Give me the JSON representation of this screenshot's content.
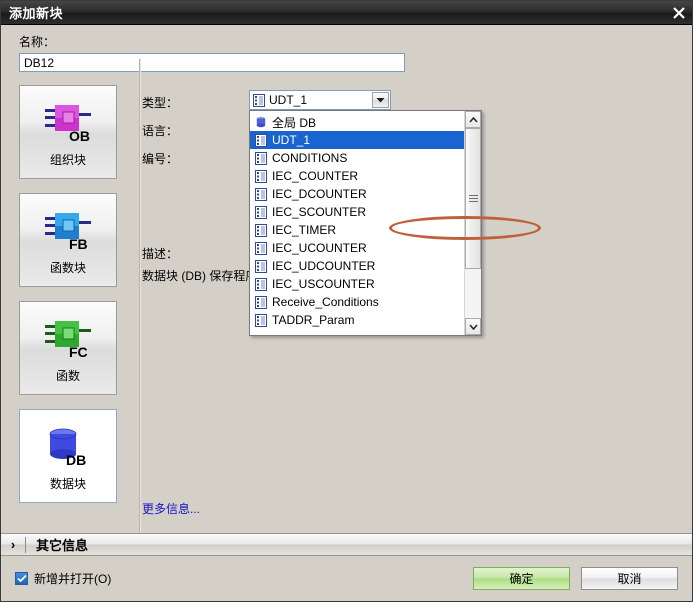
{
  "window": {
    "title": "添加新块",
    "close_icon": "close-icon"
  },
  "name_field": {
    "label": "名称：",
    "value": "DB12"
  },
  "block_types": [
    {
      "label": "组织块",
      "badge": "OB",
      "icon": "organization-block-icon",
      "color": "#cc33cc",
      "selected": false
    },
    {
      "label": "函数块",
      "badge": "FB",
      "icon": "function-block-icon",
      "color": "#1e90e0",
      "selected": false
    },
    {
      "label": "函数",
      "badge": "FC",
      "icon": "function-icon",
      "color": "#33aa33",
      "selected": false
    },
    {
      "label": "数据块",
      "badge": "DB",
      "icon": "data-block-icon",
      "color": "#3a44d8",
      "selected": true
    }
  ],
  "form": {
    "type_label": "类型：",
    "language_label": "语言：",
    "number_label": "编号：",
    "description_label": "描述：",
    "description_text": "数据块 (DB) 保存程序",
    "more_info_link": "更多信息..."
  },
  "combobox": {
    "value": "UDT_1",
    "icon": "udt-icon",
    "arrow_icon": "chevron-down-icon",
    "options": [
      {
        "label": "全局 DB",
        "icon": "global-db-icon",
        "selected": false
      },
      {
        "label": "UDT_1",
        "icon": "udt-icon",
        "selected": true
      },
      {
        "label": "CONDITIONS",
        "icon": "udt-icon",
        "selected": false
      },
      {
        "label": "IEC_COUNTER",
        "icon": "udt-icon",
        "selected": false
      },
      {
        "label": "IEC_DCOUNTER",
        "icon": "udt-icon",
        "selected": false
      },
      {
        "label": "IEC_SCOUNTER",
        "icon": "udt-icon",
        "selected": false
      },
      {
        "label": "IEC_TIMER",
        "icon": "udt-icon",
        "selected": false
      },
      {
        "label": "IEC_UCOUNTER",
        "icon": "udt-icon",
        "selected": false
      },
      {
        "label": "IEC_UDCOUNTER",
        "icon": "udt-icon",
        "selected": false
      },
      {
        "label": "IEC_USCOUNTER",
        "icon": "udt-icon",
        "selected": false
      },
      {
        "label": "Receive_Conditions",
        "icon": "udt-icon",
        "selected": false
      },
      {
        "label": "TADDR_Param",
        "icon": "udt-icon",
        "selected": false
      }
    ],
    "scroll_up_icon": "chevron-up-icon",
    "scroll_down_icon": "chevron-down-icon"
  },
  "expander": {
    "chevron": "›",
    "title": "其它信息"
  },
  "footer": {
    "checkbox_label": "新增并打开(O)",
    "checkbox_checked": true,
    "ok_label": "确定",
    "cancel_label": "取消"
  },
  "colors": {
    "selection_blue": "#1964d0",
    "annotation": "#c0603a",
    "link": "#1414c8",
    "ok_green": "#addd84"
  }
}
